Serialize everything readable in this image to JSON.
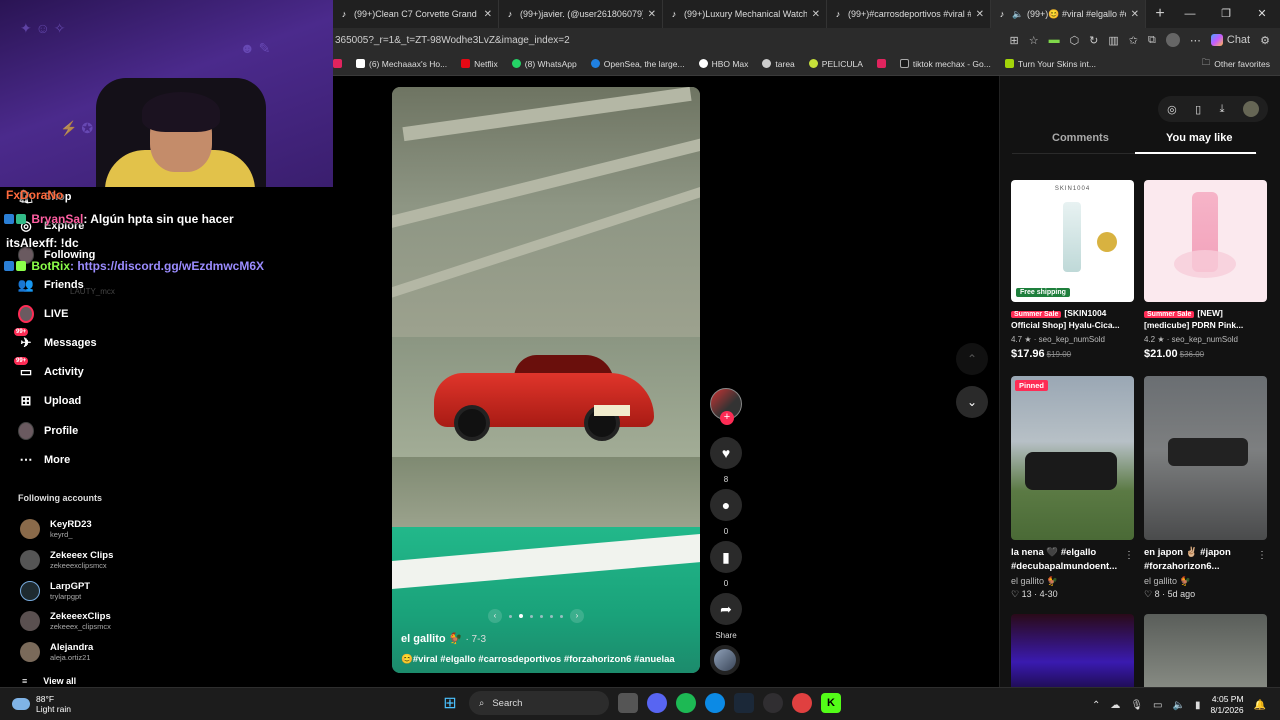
{
  "browser": {
    "tabs": [
      {
        "title": "(99+)Clean C7 Corvette Grand Sp"
      },
      {
        "title": "(99+)javier. (@user261806079)'s v"
      },
      {
        "title": "(99+)Luxury Mechanical Watches"
      },
      {
        "title": "(99+)#carrosdeportivos #viral #fo"
      },
      {
        "title": "(99+)😊 #viral #elgallo #car"
      }
    ],
    "url": "365005?_r=1&_t=ZT-98Wodhe3LvZ&image_index=2",
    "chat_label": "Chat",
    "bookmarks": [
      {
        "label": "",
        "color": "#e0245e"
      },
      {
        "label": "(6) Mechaaax's Ho...",
        "color": "#ffffff"
      },
      {
        "label": "Netflix",
        "color": "#e50914"
      },
      {
        "label": "(8) WhatsApp",
        "color": "#25d366"
      },
      {
        "label": "OpenSea, the large...",
        "color": "#2081e2"
      },
      {
        "label": "HBO Max",
        "color": "#ffffff"
      },
      {
        "label": "tarea",
        "color": "#cccccc"
      },
      {
        "label": "PELICULA",
        "color": "#c6e03a"
      },
      {
        "label": "",
        "color": "#e0245e"
      },
      {
        "label": "tiktok mechax - Go...",
        "color": "#1a1a1a"
      },
      {
        "label": "Turn Your Skins int...",
        "color": "#a3d40a"
      }
    ],
    "other_favorites": "Other favorites"
  },
  "chat_overlay": [
    {
      "user": "FxDoraNo",
      "user_color": "#ff6a3d",
      "text": ""
    },
    {
      "user": "BryanSal",
      "user_color": "#ff5fa2",
      "text": ": Algún hpta sin que hacer",
      "text_color": "#ffffff"
    },
    {
      "user": "itsAlexff",
      "user_color": "#ffffff",
      "text": ": !dc",
      "text_color": "#ffffff"
    },
    {
      "user": "BotRix",
      "user_color": "#8cff4a",
      "text": ": https://discord.gg/wEzdmwcM6X",
      "text_color": "#9b8cff"
    }
  ],
  "sidebar": {
    "nav": [
      {
        "label": "Shop",
        "icon": "shop-icon"
      },
      {
        "label": "Explore",
        "icon": "explore-icon"
      },
      {
        "label": "Following",
        "icon": "following-icon"
      },
      {
        "label": "Friends",
        "icon": "friends-icon"
      },
      {
        "label": "LIVE",
        "icon": "live-icon"
      },
      {
        "label": "Messages",
        "icon": "messages-icon",
        "badge": "99+"
      },
      {
        "label": "Activity",
        "icon": "activity-icon",
        "badge": "99+"
      },
      {
        "label": "Upload",
        "icon": "upload-icon"
      },
      {
        "label": "Profile",
        "icon": "profile-icon"
      },
      {
        "label": "More",
        "icon": "more-icon"
      }
    ],
    "following_heading": "Following accounts",
    "faded_item": "LAUTY_mcx",
    "accounts": [
      {
        "name": "KeyRD23",
        "handle": "keyrd_",
        "color": "#8a6a4a"
      },
      {
        "name": "Zekeeex Clips",
        "handle": "zekeeexclipsmcx",
        "color": "#555555"
      },
      {
        "name": "LarpGPT",
        "handle": "trylarpgpt",
        "color": "#1e2a30"
      },
      {
        "name": "ZekeeexClips",
        "handle": "zekeeex_clipsmcx",
        "color": "#5a5050"
      },
      {
        "name": "Alejandra",
        "handle": "aleja.ortiz21",
        "color": "#7a6a5a"
      }
    ],
    "view_all": "View all"
  },
  "video": {
    "username": "el gallito 🐓",
    "date": "· 7-3",
    "caption": "😊#viral #elgallo #carrosdeportivos #forzahorizon6 #anuelaa",
    "likes": "8",
    "comments": "0",
    "saves": "0",
    "share_label": "Share",
    "photo_count": 6,
    "active_photo": 2
  },
  "right_panel": {
    "tabs": [
      "Comments",
      "You may like"
    ],
    "active_tab": "You may like",
    "products": [
      {
        "brand": "SKIN1004",
        "sale_badge": "Summer Sale",
        "title": "[SKIN1004 Official Shop] Hyalu-Cica...",
        "rating": "4.7 ★",
        "seller": "seo_kep_numSold",
        "price": "$17.96",
        "old_price": "$19.00",
        "free_shipping": "Free shipping"
      },
      {
        "brand": "",
        "sale_badge": "Summer Sale",
        "title": "[NEW] [medicube] PDRN Pink...",
        "rating": "4.2 ★",
        "seller": "seo_kep_numSold",
        "price": "$21.00",
        "old_price": "$36.00",
        "free_shipping": ""
      }
    ],
    "videos": [
      {
        "pinned": "Pinned",
        "title": "la nena 🖤 #elgallo #decubapalmundoent...",
        "user": "el gallito 🐓",
        "stats": "♡ 13 · 4-30"
      },
      {
        "pinned": "",
        "title": "en japon ✌🏼 #japon #forzahorizon6...",
        "user": "el gallito 🐓",
        "stats": "♡ 8 · 5d ago"
      }
    ]
  },
  "taskbar": {
    "temp": "88°F",
    "condition": "Light rain",
    "search_label": "Search",
    "time": "4:05 PM",
    "date": "8/1/2026"
  }
}
